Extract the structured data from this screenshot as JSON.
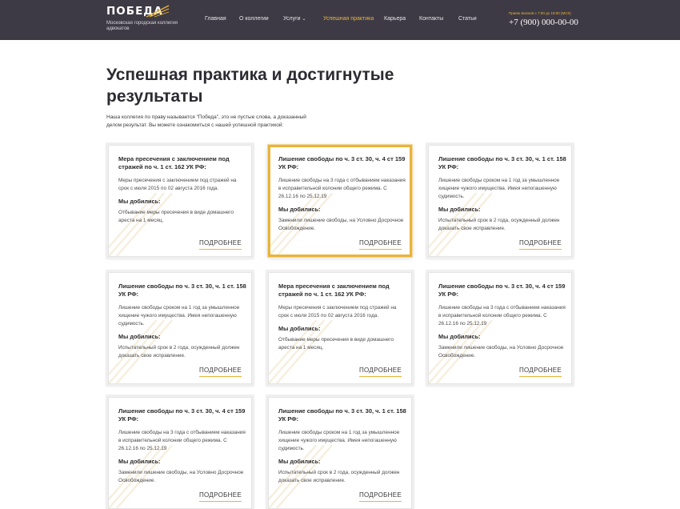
{
  "brand": {
    "name": "ПОБЕДА",
    "subtitle": "Московская городская коллегия адвокатов",
    "accent_color": "#e8b43a",
    "header_bg": "#3e3a45"
  },
  "nav": {
    "items": [
      {
        "label": "Главная"
      },
      {
        "label": "О коллегии"
      },
      {
        "label": "Услуги",
        "has_dropdown": true
      },
      {
        "label": "Успешная практика",
        "active": true
      },
      {
        "label": "Карьера"
      },
      {
        "label": "Контакты"
      },
      {
        "label": "Статьи"
      }
    ]
  },
  "contact": {
    "hours": "Прием звонков с 7:00 до 19:00 (МСК)",
    "phone": "+7 (900) 000-00-00"
  },
  "page": {
    "title": "Успешная практика и достигнутые результаты",
    "intro": "Наша коллегия по праву называется \"Победа\", это не пустые слова, а доказанный делом результат. Вы можете ознакомиться с нашей успешной практикой:"
  },
  "cards": [
    {
      "title": "Мера пресечения с заключением под стражей по ч. 1 ст. 162 УК РФ:",
      "desc": "Меры пресечения с заключением под стражей на срок с июля 2015 по 02 августа 2016 года.",
      "sub": "Мы добились:",
      "result": "Отбывание меры пресечения в виде домашнего ареста на 1 месяц.",
      "more": "ПОДРОБНЕЕ",
      "highlight": false
    },
    {
      "title": "Лишение свободы по ч. 3 ст. 30, ч. 4 ст 159 УК РФ:",
      "desc": "Лишение свободы на 3 года с отбыванием наказания в исправительной колонии общего режима. С 26.12.16 по 25.12.19",
      "sub": "Мы добились:",
      "result": "Заменили лишение свободы, на Условно Досрочное Освобождение.",
      "more": "ПОДРОБНЕЕ",
      "highlight": true
    },
    {
      "title": "Лишение свободы по ч. 3 ст. 30, ч. 1 ст. 158 УК РФ:",
      "desc": "Лишение свободы сроком на 1 год за умышленное хищение чужого имущества. Имея непогашенную судимость.",
      "sub": "Мы добились:",
      "result": "Испытательный срок в 2 года, осужденный должен доказать свое исправление.",
      "more": "ПОДРОБНЕЕ",
      "highlight": false
    },
    {
      "title": "Лишение свободы по ч. 3 ст. 30, ч. 1 ст. 158 УК РФ:",
      "desc": "Лишение свободы сроком на 1 год за умышленное хищение чужого имущества. Имея непогашенную судимость.",
      "sub": "Мы добились:",
      "result": "Испытательный срок в 2 года, осужденный должен доказать свое исправление.",
      "more": "ПОДРОБНЕЕ",
      "highlight": false
    },
    {
      "title": "Мера пресечения с заключением под стражей по ч. 1 ст. 162 УК РФ:",
      "desc": "Меры пресечения с заключением под стражей на срок с июля 2015 по 02 августа 2016 года.",
      "sub": "Мы добились:",
      "result": "Отбывание меры пресечения в виде домашнего ареста на 1 месяц.",
      "more": "ПОДРОБНЕЕ",
      "highlight": false
    },
    {
      "title": "Лишение свободы по ч. 3 ст. 30, ч. 4 ст 159 УК РФ:",
      "desc": "Лишение свободы на 3 года с отбыванием наказания в исправительной колонии общего режима. С 26.12.16 по 25.12.19",
      "sub": "Мы добились:",
      "result": "Заменили лишение свободы, на Условно Досрочное Освобождение.",
      "more": "ПОДРОБНЕЕ",
      "highlight": false
    },
    {
      "title": "Лишение свободы по ч. 3 ст. 30, ч. 4 ст 159 УК РФ:",
      "desc": "Лишение свободы на 3 года с отбыванием наказания в исправительной колонии общего режима. С 26.12.16 по 25.12.19",
      "sub": "Мы добились:",
      "result": "Заменили лишение свободы, на Условно Досрочное Освобождение.",
      "more": "ПОДРОБНЕЕ",
      "highlight": false
    },
    {
      "title": "Лишение свободы по ч. 3 ст. 30, ч. 1 ст. 158 УК РФ:",
      "desc": "Лишение свободы сроком на 1 год за умышленное хищение чужого имущества. Имея непогашенную судимость.",
      "sub": "Мы добились:",
      "result": "Испытательный срок в 2 года, осужденный должен доказать свое исправление.",
      "more": "ПОДРОБНЕЕ",
      "highlight": false
    }
  ]
}
